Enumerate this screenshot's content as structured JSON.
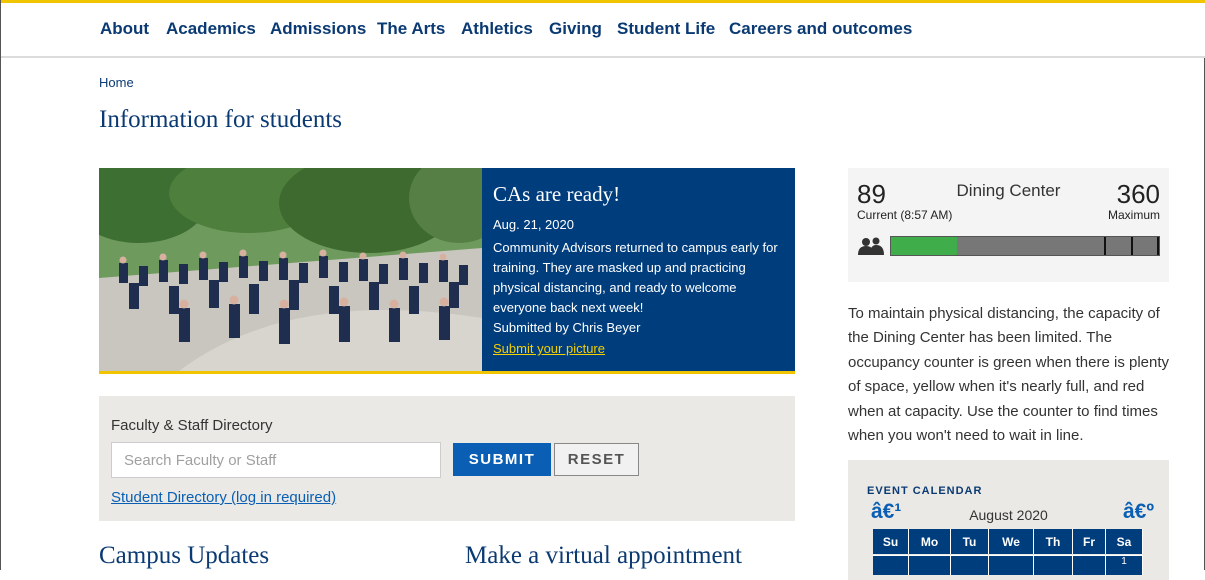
{
  "nav": {
    "items": [
      "About",
      "Academics",
      "Admissions",
      "The Arts",
      "Athletics",
      "Giving",
      "Student Life",
      "Careers and outcomes"
    ]
  },
  "breadcrumb": "Home",
  "page_title": "Information for students",
  "hero": {
    "title": "CAs are ready!",
    "date": "Aug. 21, 2020",
    "body": "Community Advisors returned to campus early for training. They are masked up and practicing physical distancing, and ready to welcome everyone back next week!",
    "submitted_by": "Submitted by Chris Beyer",
    "link": "Submit your picture"
  },
  "directory": {
    "label": "Faculty & Staff Directory",
    "placeholder": "Search Faculty or Staff",
    "submit_label": "SUBMIT",
    "reset_label": "RESET",
    "student_link": "Student Directory (log in required)"
  },
  "sections": {
    "campus_updates": "Campus Updates",
    "virtual_appointment": "Make a virtual appointment"
  },
  "counter": {
    "current": "89",
    "current_label": "Current (8:57 AM)",
    "title": "Dining Center",
    "maximum": "360",
    "maximum_label": "Maximum",
    "occupancy_fraction": 0.247,
    "fill_color": "#3fae4a",
    "icon": "people-icon"
  },
  "info_text": "To maintain physical distancing, the capacity of the Dining Center has been limited. The occupancy counter is green when there is plenty of space, yellow when it's nearly full, and red when at capacity. Use the counter to find times when you won't need to wait in line.",
  "calendar": {
    "heading": "EVENT CALENDAR",
    "prev": "â€¹",
    "next": "â€º",
    "month": "August 2020",
    "days": [
      "Su",
      "Mo",
      "Tu",
      "We",
      "Th",
      "Fr",
      "Sa"
    ],
    "first_week": [
      "",
      "",
      "",
      "",
      "",
      "",
      "1"
    ]
  },
  "colors": {
    "brand_navy": "#0b3a73",
    "accent_gold": "#f1c400",
    "button_blue": "#0a5fb4"
  }
}
